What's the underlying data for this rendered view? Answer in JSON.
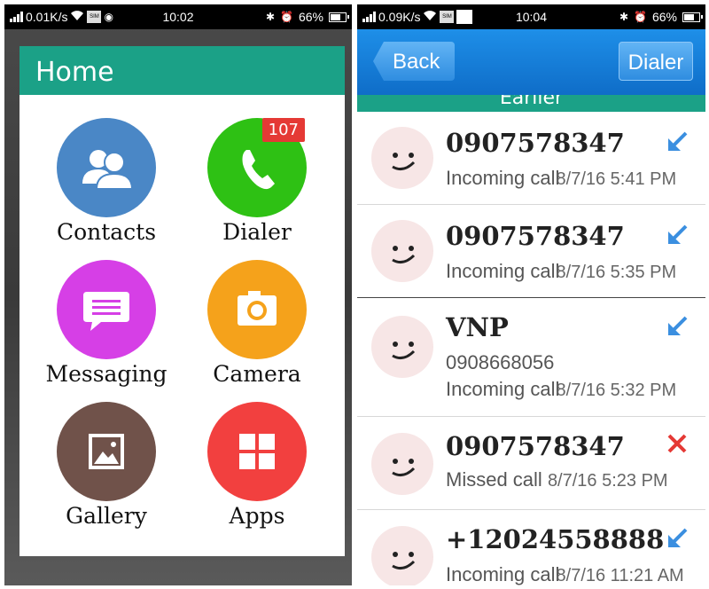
{
  "left_status": {
    "speed": "0.01K/s",
    "time": "10:02",
    "battery": "66%"
  },
  "right_status": {
    "speed": "0.09K/s",
    "time": "10:04",
    "battery": "66%"
  },
  "home": {
    "title": "Home",
    "tiles": [
      {
        "label": "Contacts",
        "icon": "contacts-icon",
        "color": "#4a87c6"
      },
      {
        "label": "Dialer",
        "icon": "phone-icon",
        "color": "#2ec114",
        "badge": "107"
      },
      {
        "label": "Messaging",
        "icon": "message-icon",
        "color": "#d63fe6"
      },
      {
        "label": "Camera",
        "icon": "camera-icon",
        "color": "#f5a21b"
      },
      {
        "label": "Gallery",
        "icon": "gallery-icon",
        "color": "#70524a"
      },
      {
        "label": "Apps",
        "icon": "apps-icon",
        "color": "#f2403f"
      }
    ]
  },
  "calllog": {
    "back_label": "Back",
    "dialer_label": "Dialer",
    "section_label": "Earlier",
    "calls": [
      {
        "name": "0907578347",
        "type": "Incoming call",
        "time": "8/7/16 5:41 PM",
        "direction": "incoming"
      },
      {
        "name": "0907578347",
        "type": "Incoming call",
        "time": "8/7/16 5:35 PM",
        "direction": "incoming"
      },
      {
        "name": "VNP",
        "number": "0908668056",
        "type": "Incoming call",
        "time": "8/7/16 5:32 PM",
        "direction": "incoming"
      },
      {
        "name": "0907578347",
        "type": "Missed call",
        "time": "8/7/16 5:23 PM",
        "direction": "missed"
      },
      {
        "name": "+12024558888",
        "type": "Incoming call",
        "time": "8/7/16 11:21 AM",
        "direction": "incoming"
      }
    ]
  },
  "colors": {
    "teal": "#1ba187",
    "actionbar_blue": "#1680de",
    "incoming_arrow": "#3b8fe0",
    "missed_x": "#e53935",
    "badge_red": "#e53935"
  }
}
